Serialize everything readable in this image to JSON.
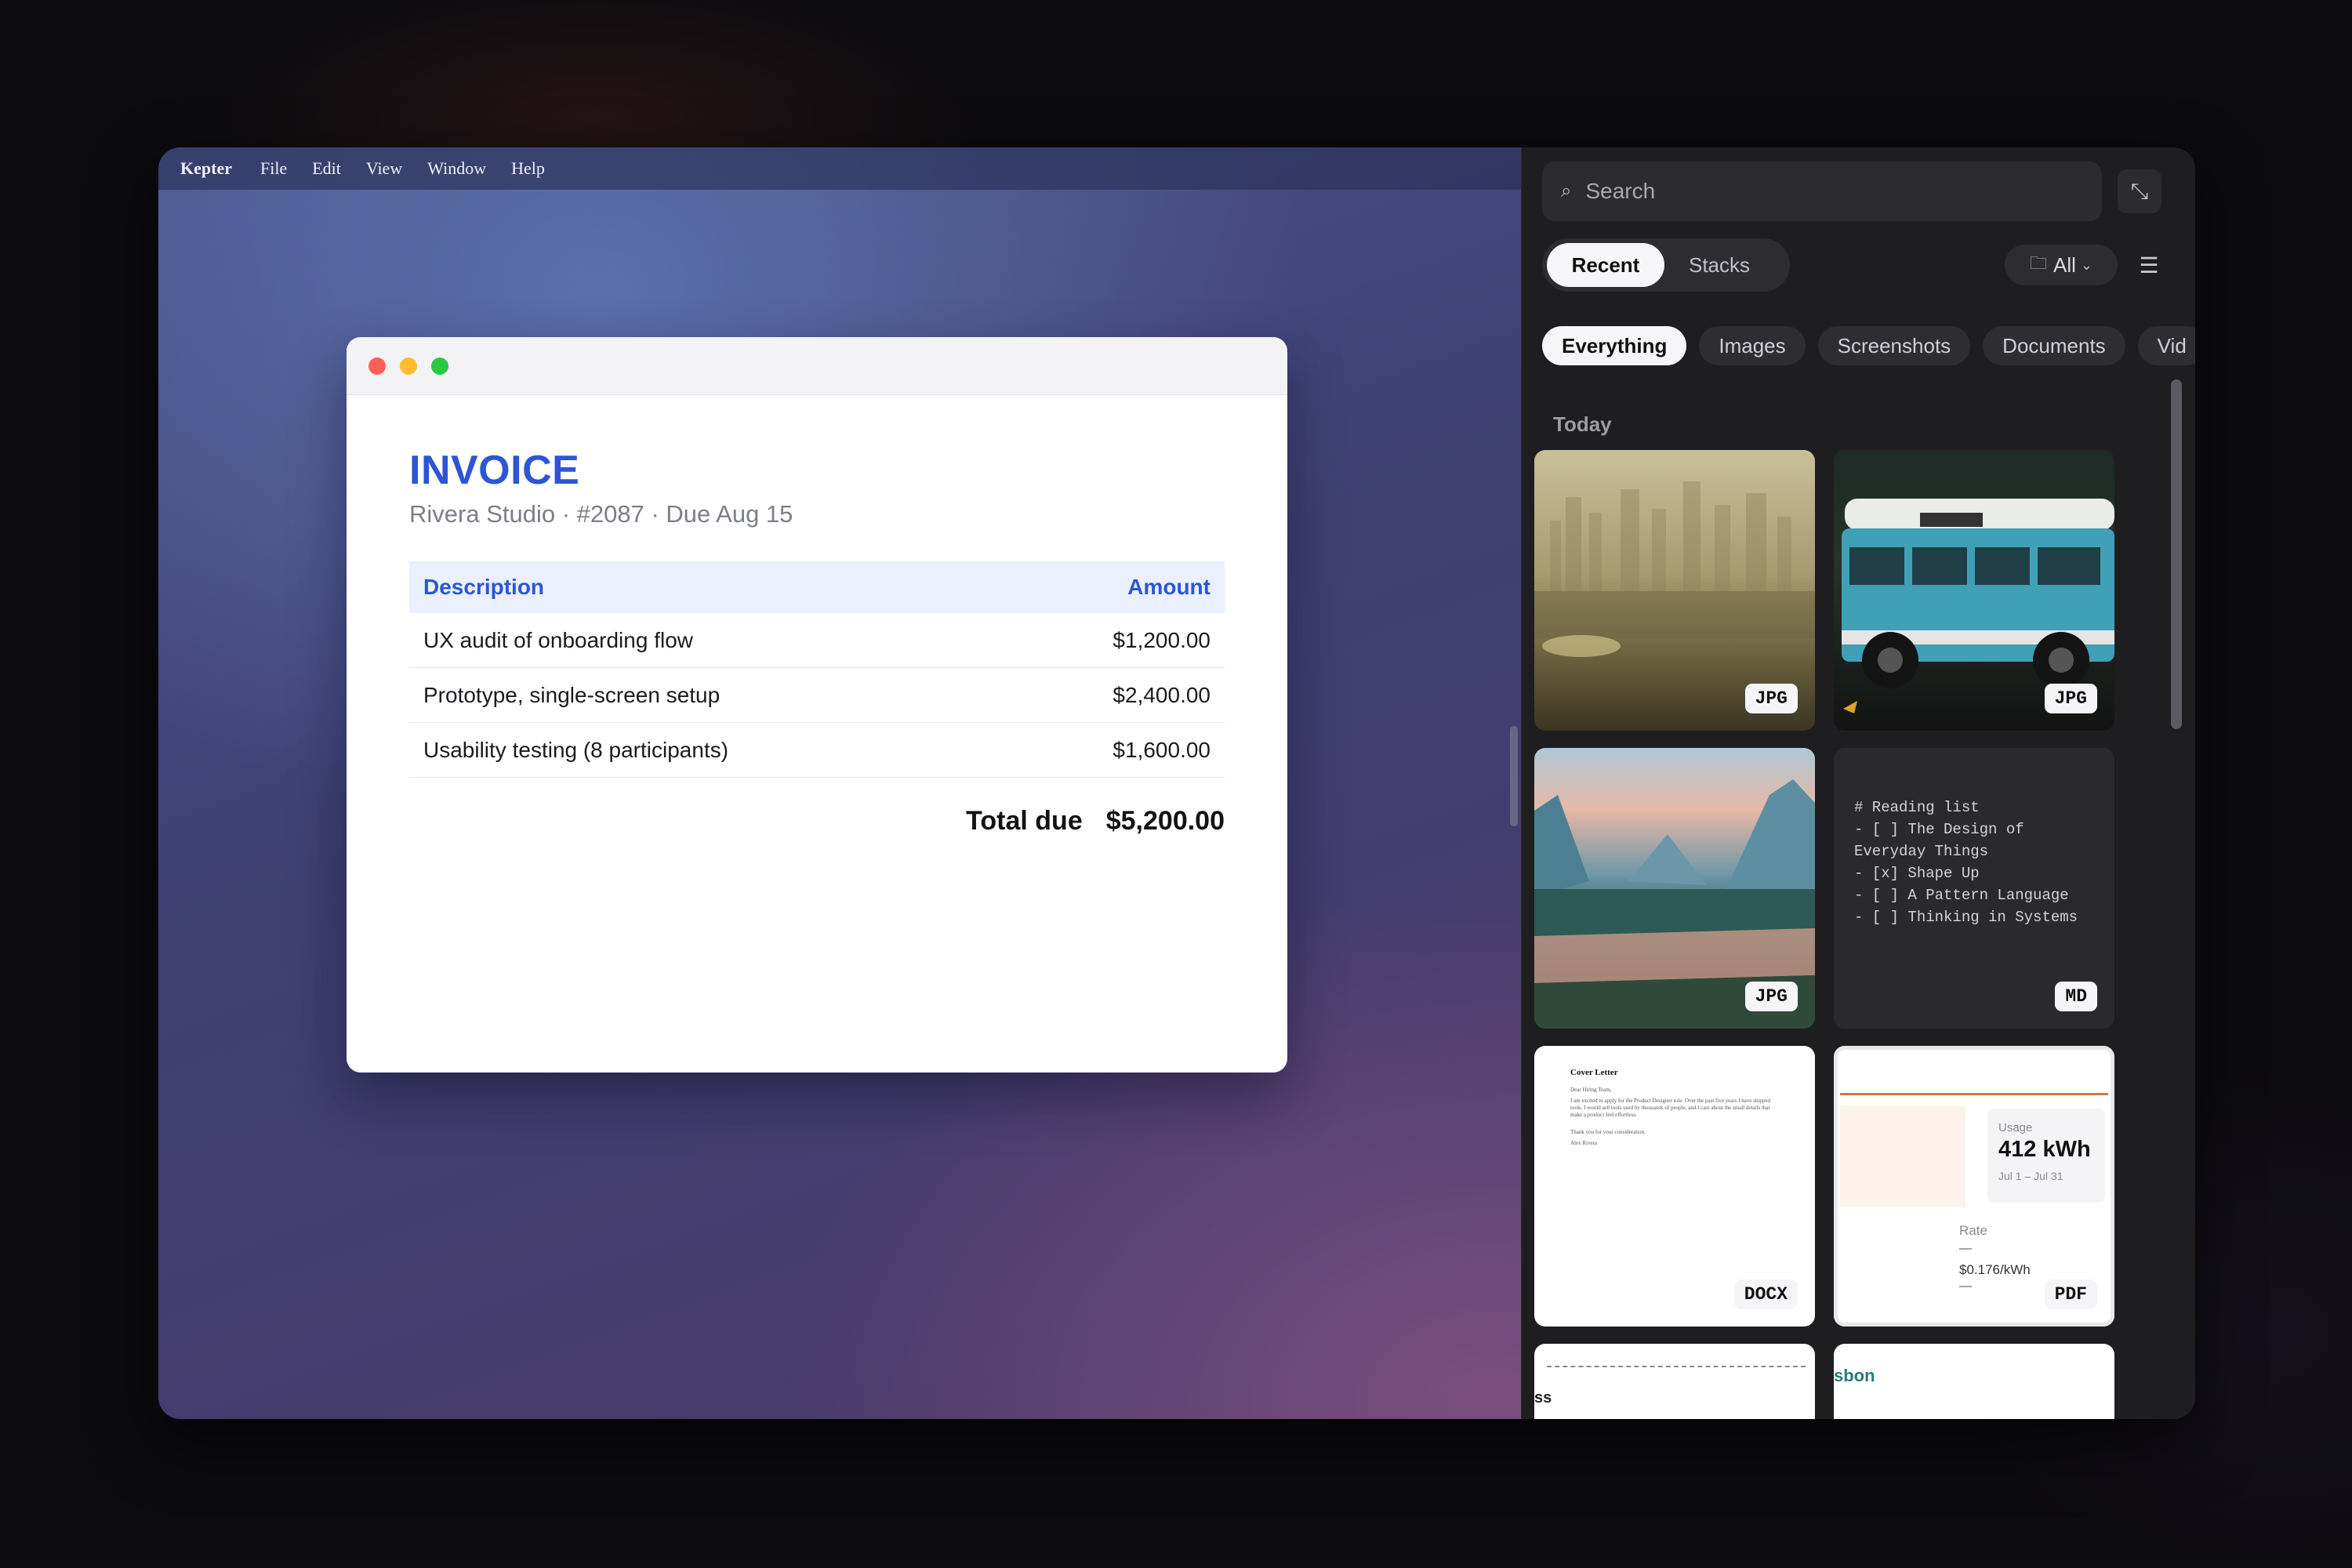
{
  "menubar": {
    "app": "Kepter",
    "items": [
      "File",
      "Edit",
      "View",
      "Window",
      "Help"
    ]
  },
  "invoice": {
    "title": "INVOICE",
    "subtitle": "Rivera Studio · #2087 · Due Aug 15",
    "headers": {
      "description": "Description",
      "amount": "Amount"
    },
    "rows": [
      {
        "description": "UX audit of onboarding flow",
        "amount": "$1,200.00"
      },
      {
        "description": "Prototype, single-screen setup",
        "amount": "$2,400.00"
      },
      {
        "description": "Usability testing (8 participants)",
        "amount": "$1,600.00"
      }
    ],
    "total_label": "Total due",
    "total_value": "$5,200.00"
  },
  "panel": {
    "search_placeholder": "Search",
    "search_icon": "search-icon",
    "expand_icon": "expand-icon",
    "segments": [
      "Recent",
      "Stacks"
    ],
    "active_segment": "Recent",
    "scope": "All",
    "scope_icon": "folder-icon",
    "filter_icon": "sliders-icon",
    "chips": [
      "Everything",
      "Images",
      "Screenshots",
      "Documents",
      "Vid"
    ],
    "active_chip": "Everything",
    "section": "Today",
    "tiles": [
      {
        "kind": "photo-city-fog",
        "badge": "JPG"
      },
      {
        "kind": "photo-blue-van",
        "badge": "JPG"
      },
      {
        "kind": "photo-mountain-river",
        "badge": "JPG"
      },
      {
        "kind": "markdown",
        "badge": "MD",
        "text": "# Reading list\n- [ ] The Design of\nEveryday Things\n- [x] Shape Up\n- [ ] A Pattern Language\n- [ ] Thinking in Systems"
      },
      {
        "kind": "document",
        "badge": "DOCX",
        "title": "Cover Letter",
        "greeting": "Dear Hiring Team,",
        "body": "I am excited to apply for the Product Designer role. Over the past five years I have shipped tools. I would sell tools used by thousands of people, and I care about the small details that make a product feel effortless.",
        "thanks": "Thank you for your consideration.",
        "signature": "Alex Rivera"
      },
      {
        "kind": "pdf",
        "badge": "PDF",
        "usage_label": "Usage",
        "usage_value": "412 kWh",
        "usage_range": "Jul 1 – Jul 31",
        "rate_label": "Rate",
        "rate_value": "$0.176/kWh",
        "dash": "—"
      },
      {
        "kind": "partial",
        "text": "ss"
      },
      {
        "kind": "partial",
        "text": "sbon"
      }
    ]
  },
  "colors": {
    "accent": "#2d55d6",
    "panel_bg": "#1e1e20",
    "pdf_accent": "#c97b4a"
  }
}
